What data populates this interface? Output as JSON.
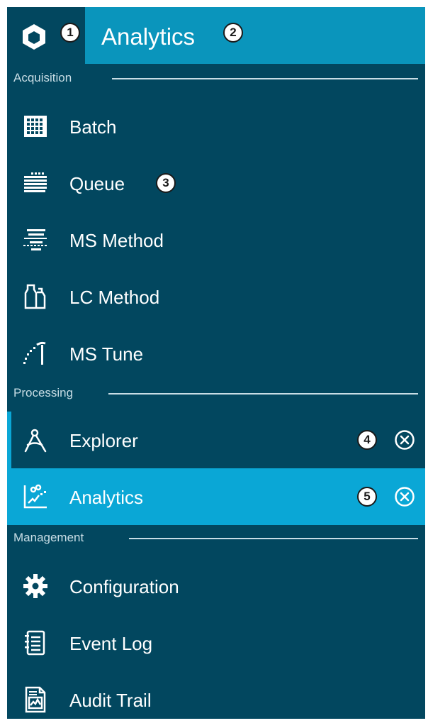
{
  "header": {
    "title": "Analytics",
    "logo_badge": "1",
    "title_badge": "2"
  },
  "colors": {
    "panel": "#02475f",
    "header_accent": "#0a95bc",
    "active_item": "#0aa7d6",
    "text": "#ffffff",
    "section_text": "#c8dde5"
  },
  "sections": [
    {
      "label": "Acquisition"
    },
    {
      "label": "Processing"
    },
    {
      "label": "Management"
    }
  ],
  "items": [
    {
      "label": "Batch",
      "icon": "grid-icon"
    },
    {
      "label": "Queue",
      "icon": "stack-icon",
      "badge": "3"
    },
    {
      "label": "MS Method",
      "icon": "ms-method-icon"
    },
    {
      "label": "LC Method",
      "icon": "bottle-icon"
    },
    {
      "label": "MS Tune",
      "icon": "tune-icon"
    },
    {
      "label": "Explorer",
      "icon": "compass-icon",
      "badge": "4",
      "closable": true
    },
    {
      "label": "Analytics",
      "icon": "scatter-chart-icon",
      "badge": "5",
      "closable": true,
      "selected": true
    },
    {
      "label": "Configuration",
      "icon": "gear-icon"
    },
    {
      "label": "Event Log",
      "icon": "notebook-icon"
    },
    {
      "label": "Audit Trail",
      "icon": "report-icon"
    }
  ]
}
